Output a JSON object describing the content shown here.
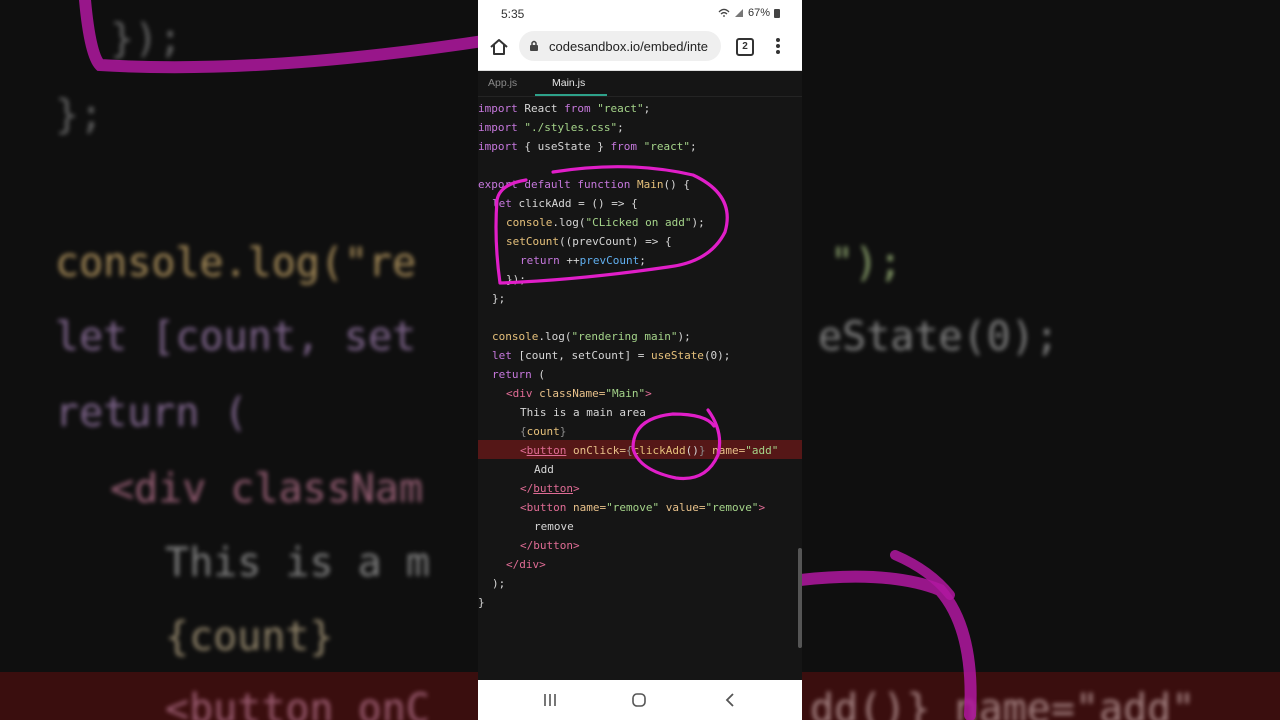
{
  "background": {
    "lines": [
      "});",
      "};",
      "console.log(\"re",
      "\");",
      "let [count, set",
      "eState(0);",
      "return (",
      "<div classNam",
      "This is a m",
      "{count}",
      "<button onC",
      "dd()} name=\"add\""
    ]
  },
  "statusbar": {
    "time": "5:35",
    "battery": "67%"
  },
  "browser": {
    "url": "codesandbox.io/embed/inte",
    "tab_count": "2"
  },
  "editor": {
    "tabs": [
      {
        "label": "App.js",
        "active": false
      },
      {
        "label": "Main.js",
        "active": true
      }
    ]
  },
  "code": {
    "l1": {
      "kw1": "import",
      "t1": " React ",
      "kw2": "from",
      "s1": " \"react\"",
      "p": ";"
    },
    "l2": {
      "kw1": "import",
      "s1": " \"./styles.css\"",
      "p": ";"
    },
    "l3": {
      "kw1": "import",
      "t1": " { useState } ",
      "kw2": "from",
      "s1": " \"react\"",
      "p": ";"
    },
    "l5": {
      "kw1": "export",
      "kw2": " default",
      "kw3": " function",
      "f": " Main",
      "t": "() {"
    },
    "l6": {
      "kw": "let",
      "t": " clickAdd = () => {"
    },
    "l7": {
      "f": "console",
      "t1": ".log(",
      "s": "\"CLicked on add\"",
      "t2": ");"
    },
    "l8": {
      "f": "setCount",
      "t": "((prevCount) => {"
    },
    "l9": {
      "kw": "return",
      "t": " ++",
      "v": "prevCount",
      "p": ";"
    },
    "l10": "});",
    "l11": "};",
    "l13": {
      "f": "console",
      "t1": ".log(",
      "s": "\"rendering main\"",
      "t2": ");"
    },
    "l14": {
      "kw": "let",
      "t": " [count, setCount] = ",
      "f": "useState",
      "t2": "(0);"
    },
    "l15": {
      "kw": "return",
      "t": " ("
    },
    "l16": {
      "tg1": "<div ",
      "a": "className=",
      "s": "\"Main\"",
      "tg2": ">"
    },
    "l17": "This is a main area",
    "l18": {
      "b1": "{",
      "v": "count",
      "b2": "}"
    },
    "l19": {
      "tg1": "<",
      "tn": "button",
      "a": " onClick=",
      "b1": "{",
      "f": "clickAdd",
      "t": "()",
      "b2": "}",
      "a2": " name=",
      "s": "\"add\""
    },
    "l20": "Add",
    "l21": {
      "tg1": "</",
      "tn": "button",
      "tg2": ">"
    },
    "l22": {
      "tg1": "<button ",
      "a": "name=",
      "s": "\"remove\"",
      "a2": " value=",
      "s2": "\"remove\"",
      "tg2": ">"
    },
    "l23": "remove",
    "l24": "</button>",
    "l25": "</div>",
    "l26": ");",
    "l27": "}"
  },
  "colors": {
    "annotation": "#e01ec8",
    "highlight_line": "#551717",
    "tab_underline": "#2ea18a"
  },
  "icons": [
    "home-icon",
    "lock-icon",
    "tabs-icon",
    "more-vert-icon",
    "wifi-icon",
    "signal-icon",
    "battery-icon",
    "recents-icon",
    "nav-home-icon",
    "back-icon"
  ]
}
